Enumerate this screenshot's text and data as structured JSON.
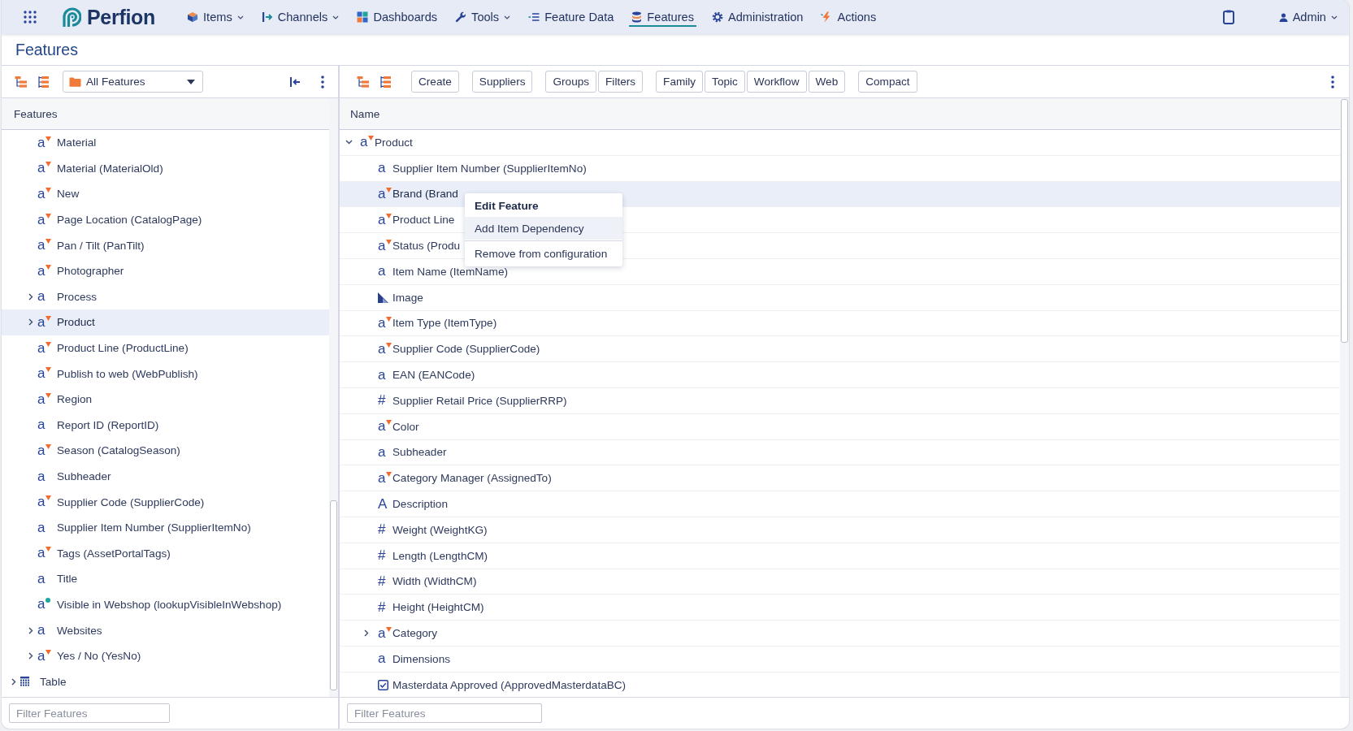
{
  "top_nav": {
    "logo": {
      "text": "Perfion"
    },
    "menu": [
      {
        "label": "Items",
        "dropdown": true,
        "selected": false
      },
      {
        "label": "Channels",
        "dropdown": true,
        "selected": false
      },
      {
        "label": "Dashboards",
        "dropdown": false,
        "selected": false
      },
      {
        "label": "Tools",
        "dropdown": true,
        "selected": false
      },
      {
        "label": "Feature Data",
        "dropdown": false,
        "selected": false
      },
      {
        "label": "Features",
        "dropdown": false,
        "selected": true
      },
      {
        "label": "Administration",
        "dropdown": false,
        "selected": false
      },
      {
        "label": "Actions",
        "dropdown": false,
        "selected": false
      }
    ],
    "user": {
      "label": "Admin",
      "dropdown": true
    }
  },
  "page_title": "Features",
  "left_panel": {
    "selector": {
      "value": "All Features"
    },
    "column_header": "Features",
    "tree": [
      {
        "children": [
          {
            "label": "Material",
            "kind": "select",
            "glyph": "a",
            "selected": false
          },
          {
            "label": "Material (MaterialOld)",
            "kind": "select",
            "glyph": "a",
            "selected": false
          },
          {
            "label": "New",
            "kind": "select",
            "glyph": "a",
            "selected": false
          },
          {
            "label": "Page Location (CatalogPage)",
            "kind": "select",
            "glyph": "a",
            "selected": false
          },
          {
            "label": "Pan / Tilt (PanTilt)",
            "kind": "select",
            "glyph": "a",
            "selected": false
          },
          {
            "label": "Photographer",
            "kind": "select",
            "glyph": "a",
            "selected": false
          },
          {
            "label": "Process",
            "kind": "plain",
            "glyph": "a",
            "expanded": false,
            "selected": false
          },
          {
            "label": "Product",
            "kind": "select",
            "glyph": "a",
            "expanded": false,
            "selected": true
          },
          {
            "label": "Product Line (ProductLine)",
            "kind": "select",
            "glyph": "a",
            "selected": false
          },
          {
            "label": "Publish to web (WebPublish)",
            "kind": "select",
            "glyph": "a",
            "selected": false
          },
          {
            "label": "Region",
            "kind": "select",
            "glyph": "a",
            "selected": false
          },
          {
            "label": "Report ID (ReportID)",
            "kind": "plain",
            "glyph": "a",
            "selected": false
          },
          {
            "label": "Season (CatalogSeason)",
            "kind": "select",
            "glyph": "a",
            "selected": false
          },
          {
            "label": "Subheader",
            "kind": "plain",
            "glyph": "a",
            "selected": false
          },
          {
            "label": "Supplier Code (SupplierCode)",
            "kind": "select",
            "glyph": "a",
            "selected": false
          },
          {
            "label": "Supplier Item Number (SupplierItemNo)",
            "kind": "plain",
            "glyph": "a",
            "selected": false
          },
          {
            "label": "Tags (AssetPortalTags)",
            "kind": "select",
            "glyph": "a",
            "selected": false
          },
          {
            "label": "Title",
            "kind": "plain",
            "glyph": "a",
            "selected": false
          },
          {
            "label": "Visible in Webshop (lookupVisibleInWebshop)",
            "kind": "lookup",
            "glyph": "a",
            "selected": false
          },
          {
            "label": "Websites",
            "kind": "plain",
            "glyph": "a",
            "expanded": false,
            "selected": false
          },
          {
            "label": "Yes / No (YesNo)",
            "kind": "select",
            "glyph": "a",
            "expanded": false,
            "selected": false
          }
        ]
      },
      {
        "label": "Table",
        "kind": "table",
        "expanded": false,
        "selected": false
      }
    ],
    "filter": {
      "placeholder": "Filter Features"
    }
  },
  "right_panel": {
    "toolbar": {
      "button_groups": [
        [
          "Create"
        ],
        [
          "Suppliers"
        ],
        [
          "Groups",
          "Filters"
        ],
        [
          "Family",
          "Topic",
          "Workflow",
          "Web"
        ],
        [
          "Compact"
        ]
      ]
    },
    "table": {
      "columns": [
        "Name"
      ],
      "rows": [
        {
          "label": "Product",
          "kind": "select",
          "glyph": "a",
          "expanded": true,
          "selected": false,
          "children": [
            {
              "label": "Supplier Item Number (SupplierItemNo)",
              "kind": "plain",
              "glyph": "a",
              "selected": false
            },
            {
              "label": "Brand (Brand",
              "kind": "select",
              "glyph": "a",
              "selected": true
            },
            {
              "label": "Product Line",
              "kind": "select",
              "glyph": "a",
              "selected": false
            },
            {
              "label": "Status (Produ",
              "kind": "select",
              "glyph": "a",
              "selected": false
            },
            {
              "label": "Item Name (ItemName)",
              "kind": "plain",
              "glyph": "a",
              "selected": false
            },
            {
              "label": "Image",
              "kind": "image",
              "selected": false
            },
            {
              "label": "Item Type (ItemType)",
              "kind": "select",
              "glyph": "a",
              "selected": false
            },
            {
              "label": "Supplier Code (SupplierCode)",
              "kind": "select",
              "glyph": "a",
              "selected": false
            },
            {
              "label": "EAN (EANCode)",
              "kind": "plain",
              "glyph": "a",
              "selected": false
            },
            {
              "label": "Supplier Retail Price (SupplierRRP)",
              "kind": "plain",
              "glyph": "#",
              "selected": false
            },
            {
              "label": "Color",
              "kind": "select",
              "glyph": "a",
              "selected": false
            },
            {
              "label": "Subheader",
              "kind": "plain",
              "glyph": "a",
              "selected": false
            },
            {
              "label": "Category Manager (AssignedTo)",
              "kind": "select",
              "glyph": "a",
              "selected": false
            },
            {
              "label": "Description",
              "kind": "plain",
              "glyph": "A",
              "selected": false
            },
            {
              "label": "Weight (WeightKG)",
              "kind": "plain",
              "glyph": "#",
              "selected": false
            },
            {
              "label": "Length (LengthCM)",
              "kind": "plain",
              "glyph": "#",
              "selected": false
            },
            {
              "label": "Width (WidthCM)",
              "kind": "plain",
              "glyph": "#",
              "selected": false
            },
            {
              "label": "Height (HeightCM)",
              "kind": "plain",
              "glyph": "#",
              "selected": false
            },
            {
              "label": "Category",
              "kind": "select",
              "glyph": "a",
              "expanded": false,
              "selected": false
            },
            {
              "label": "Dimensions",
              "kind": "plain",
              "glyph": "a",
              "selected": false
            },
            {
              "label": "Masterdata Approved (ApprovedMasterdataBC)",
              "kind": "boolean",
              "selected": false
            }
          ]
        }
      ]
    },
    "filter": {
      "placeholder": "Filter Features"
    }
  },
  "context_menu": {
    "items": [
      {
        "label": "Edit Feature",
        "kind": "default",
        "selected": false
      },
      {
        "label": "Add Item Dependency",
        "kind": "item",
        "selected": true
      },
      {
        "kind": "separator"
      },
      {
        "label": "Remove from configuration",
        "kind": "item",
        "selected": false
      }
    ]
  }
}
